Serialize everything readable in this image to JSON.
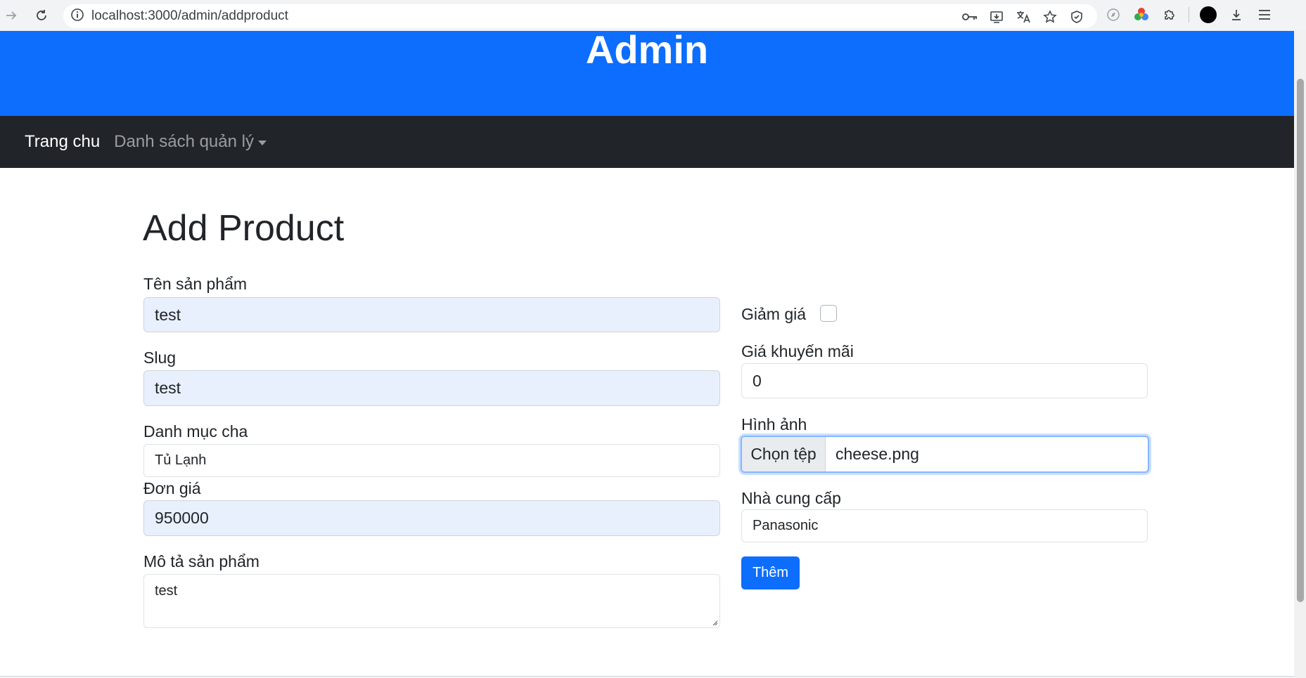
{
  "browser": {
    "url": "localhost:3000/admin/addproduct"
  },
  "header": {
    "title": "Admin"
  },
  "navbar": {
    "home": "Trang chu",
    "dropdown": "Danh sách quản lý"
  },
  "page": {
    "title": "Add Product"
  },
  "form": {
    "name_label": "Tên sản phẩm",
    "name_value": "test",
    "slug_label": "Slug",
    "slug_value": "test",
    "category_label": "Danh mục cha",
    "category_value": "Tủ Lạnh",
    "price_label": "Đơn giá",
    "price_value": "950000",
    "description_label": "Mô tả sản phẩm",
    "description_value": "test",
    "discount_label": "Giảm giá",
    "discount_checked": false,
    "sale_price_label": "Giá khuyến mãi",
    "sale_price_value": "0",
    "image_label": "Hình ảnh",
    "image_button": "Chọn tệp",
    "image_file": "cheese.png",
    "supplier_label": "Nhà cung cấp",
    "supplier_value": "Panasonic",
    "submit_label": "Thêm"
  },
  "colors": {
    "header_bg": "#0d6efd",
    "navbar_bg": "#212529",
    "autofill_bg": "#e8f0fe",
    "focus_border": "#86b7fe"
  }
}
